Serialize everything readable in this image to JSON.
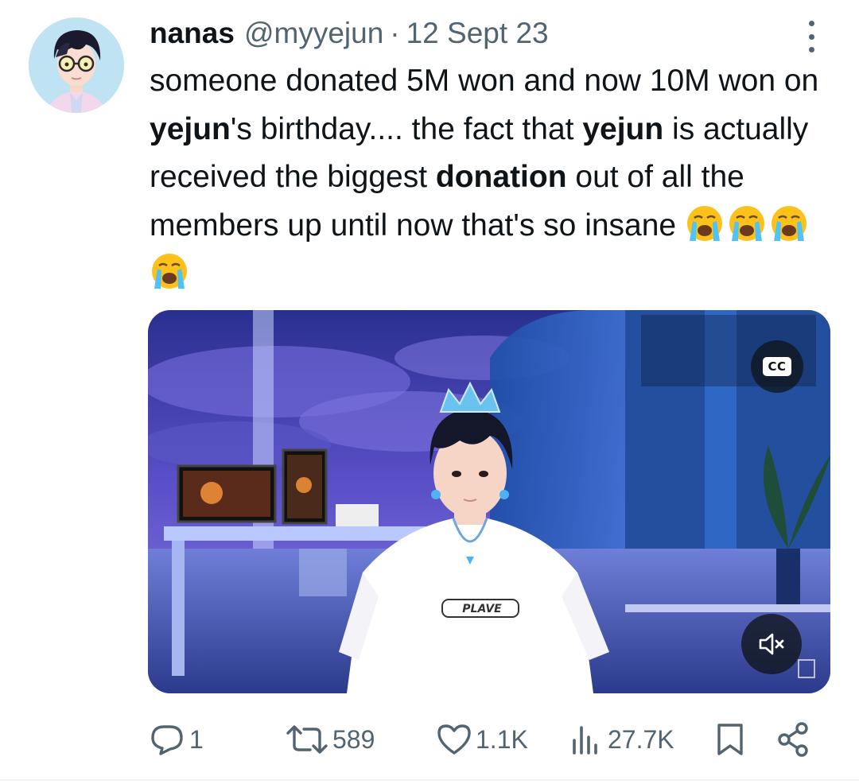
{
  "tweet": {
    "display_name": "nanas",
    "handle": "@myyejun",
    "separator": "·",
    "date": "12 Sept 23",
    "avatar_icon": "anime-avatar-glasses",
    "more_icon": "more-vertical-icon",
    "text_segments": [
      {
        "text": "someone donated 5M won and now 10M won on ",
        "bold": false
      },
      {
        "text": "yejun",
        "bold": true
      },
      {
        "text": "'s birthday.... the fact that ",
        "bold": false
      },
      {
        "text": "yejun",
        "bold": true
      },
      {
        "text": " is actually received the biggest ",
        "bold": false
      },
      {
        "text": "donation",
        "bold": true
      },
      {
        "text": " out of all the members up until now that's so insane ",
        "bold": false
      }
    ],
    "emojis": [
      "loudly-crying-face",
      "loudly-crying-face",
      "loudly-crying-face",
      "loudly-crying-face"
    ]
  },
  "media": {
    "type": "video",
    "shirt_text": "PLAVE",
    "cc_label": "CC",
    "mute_icon": "muted-speaker-icon"
  },
  "actions": {
    "reply": {
      "icon": "reply-icon",
      "count": "1"
    },
    "retweet": {
      "icon": "retweet-icon",
      "count": "589"
    },
    "like": {
      "icon": "heart-icon",
      "count": "1.1K"
    },
    "views": {
      "icon": "views-chart-icon",
      "count": "27.7K"
    },
    "bookmark": {
      "icon": "bookmark-icon"
    },
    "share": {
      "icon": "share-icon"
    }
  },
  "colors": {
    "text_primary": "#0f1419",
    "text_secondary": "#536471",
    "media_overlay": "#0f1419"
  }
}
